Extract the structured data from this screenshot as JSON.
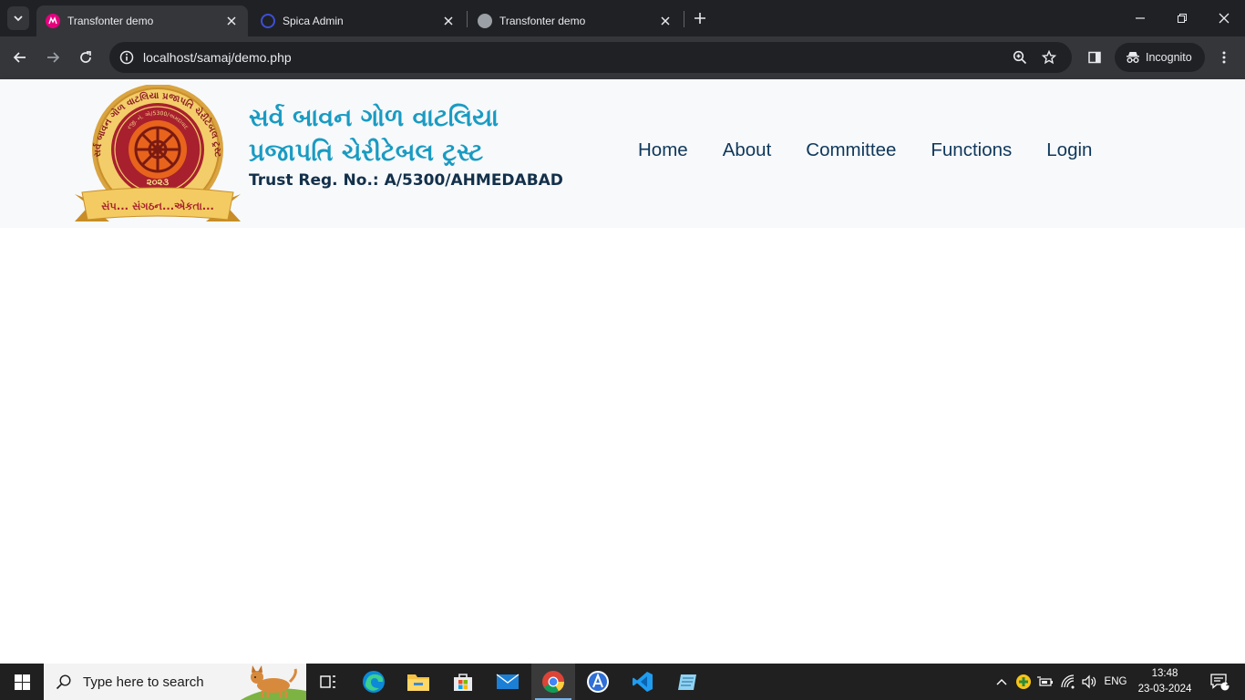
{
  "browser": {
    "tabs": [
      {
        "title": "Transfonter demo",
        "active": true,
        "favicon_color": "#e6007e"
      },
      {
        "title": "Spica Admin",
        "active": false,
        "favicon_color": "#3d4fd6"
      },
      {
        "title": "Transfonter demo",
        "active": false,
        "favicon_color": "#9aa0a6"
      }
    ],
    "url": "localhost/samaj/demo.php",
    "incognito_label": "Incognito"
  },
  "site": {
    "logo": {
      "top_arc_text": "સર્વ બાવન ગોળ વાટલિયા પ્રજાપતિ ચેરીટેબલ ટ્રસ્ટ",
      "inner_arc_text": "રજી. નં. એ/5300/અમદાવાદ",
      "year": "૨૦૨૩",
      "ribbon_text": "સંપ... સંગઠન...એકતા..."
    },
    "trust_name_line1": "સર્વ બાવન ગોળ વાટલિયા",
    "trust_name_line2": "પ્રજાપતિ ચેરીટેબલ ટ્રસ્ટ",
    "trust_reg": "Trust Reg. No.: A/5300/AHMEDABAD",
    "nav": [
      "Home",
      "About",
      "Committee",
      "Functions",
      "Login"
    ],
    "colors": {
      "title": "#1a9bc2",
      "nav": "#10385a",
      "reg": "#13304a",
      "header_bg": "#f7f9fb"
    }
  },
  "taskbar": {
    "search_placeholder": "Type here to search",
    "language": "ENG",
    "time": "13:48",
    "date": "23-03-2024",
    "notification_count": "1",
    "pinned_apps": [
      "task-view",
      "edge",
      "file-explorer",
      "microsoft-store",
      "mail",
      "chrome",
      "app-a",
      "vscode",
      "notepad"
    ]
  }
}
